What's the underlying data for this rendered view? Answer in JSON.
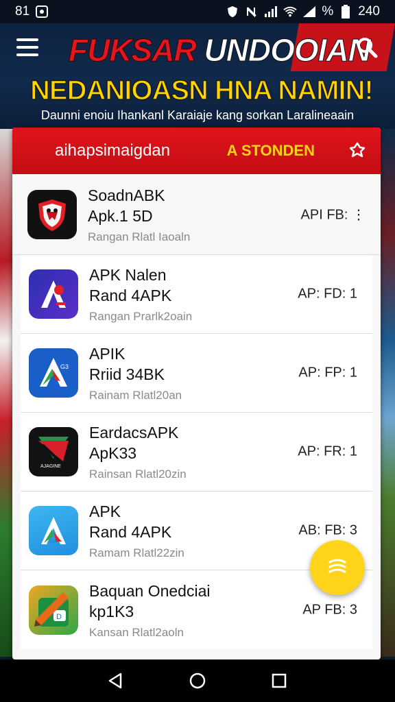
{
  "status_bar": {
    "time_left": "81",
    "time_right": "240",
    "percent": "%"
  },
  "banner": {
    "headline_word1": "FUKSAR",
    "headline_word2": "UNDOOIAN",
    "headline_line2": "NEDANIOASN HNA NAMIN!",
    "subtitle": "Daunni enoiu Ihankanl Karaiaje kang sorkan Laralineaain",
    "icons": [
      "menu-icon",
      "search-icon"
    ]
  },
  "card": {
    "tab_main": "aihapsimaigdan",
    "tab_second": "A STONDEN",
    "header_icon": "puzzle-icon"
  },
  "apps": [
    {
      "name_line1": "SoadnABK",
      "name_line2": "Apk.1 5D",
      "sub": "Rangan Rlatl Iaoaln",
      "meta": "API FB: ⋮",
      "icon": "shield-icon"
    },
    {
      "name_line1": "APK Nalen",
      "name_line2": "Rand 4APK",
      "sub": "Rangan Prarlk2oain",
      "meta": "AP: FD: 1",
      "icon": "a-logo-icon"
    },
    {
      "name_line1": "APIK",
      "name_line2": "Rriid 34BK",
      "sub": "Rainam Rlatl20an",
      "meta": "AP: FP: 1",
      "icon": "a-logo-icon"
    },
    {
      "name_line1": "EardacsAPK",
      "name_line2": "ApK33",
      "sub": "Rainsan Rlatl20zin",
      "meta": "AP: FR: 1",
      "icon": "arrow-logo-icon"
    },
    {
      "name_line1": "APK",
      "name_line2": "Rand 4APK",
      "sub": "Ramam Rlatl22zin",
      "meta": "AB: FB: 3",
      "icon": "a-logo-icon"
    },
    {
      "name_line1": "Baquan Onedciai",
      "name_line2": "kp1K3",
      "sub": "Kansan Rlatl2aoln",
      "meta": "AP FB: 3",
      "icon": "pencil-icon"
    }
  ],
  "fab": {
    "icon": "stack-icon"
  },
  "nav": {
    "icons": [
      "back-icon",
      "home-icon",
      "recents-icon"
    ]
  },
  "colors": {
    "primary_red": "#d3131a",
    "accent_yellow": "#ffd41a",
    "banner_blue": "#0d2240"
  }
}
